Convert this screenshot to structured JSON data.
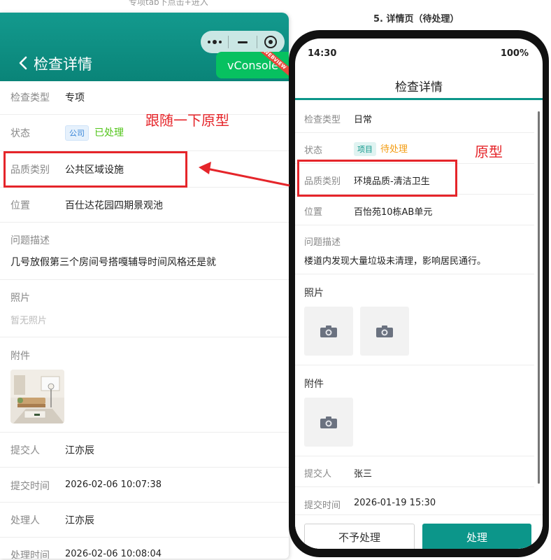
{
  "captions": {
    "top": "专项tab下点击+进入",
    "right": "5. 详情页（待处理）"
  },
  "left": {
    "title": "检查详情",
    "vconsole": "vConsole",
    "ribbon": "WEBVIEW",
    "inspect_type": {
      "label": "检查类型",
      "value": "专项"
    },
    "status": {
      "label": "状态",
      "tag": "公司",
      "value": "已处理"
    },
    "quality_category": {
      "label": "品质类别",
      "value": "公共区域设施"
    },
    "location": {
      "label": "位置",
      "value": "百仕达花园四期景观池"
    },
    "problem": {
      "label": "问题描述",
      "value": "几号放假第三个房间号搭嘎辅导时间风格还是就"
    },
    "photos": {
      "label": "照片",
      "empty": "暂无照片"
    },
    "attachments": {
      "label": "附件"
    },
    "submitter": {
      "label": "提交人",
      "value": "江亦辰"
    },
    "submit_time": {
      "label": "提交时间",
      "value": "2026-02-06 10:07:38"
    },
    "handler": {
      "label": "处理人",
      "value": "江亦辰"
    },
    "handle_time": {
      "label": "处理时间",
      "value": "2026-02-06 10:08:04"
    }
  },
  "annotations": {
    "follow": "跟随一下原型",
    "prototype": "原型"
  },
  "right": {
    "time": "14:30",
    "battery": "100%",
    "title": "检查详情",
    "inspect_type": {
      "label": "检查类型",
      "value": "日常"
    },
    "status": {
      "label": "状态",
      "tag": "项目",
      "value": "待处理"
    },
    "quality_category": {
      "label": "品质类别",
      "value": "环境品质-清洁卫生"
    },
    "location": {
      "label": "位置",
      "value": "百怡苑10栋AB单元"
    },
    "problem": {
      "label": "问题描述",
      "value": "楼道内发现大量垃圾未清理，影响居民通行。"
    },
    "photos": {
      "label": "照片"
    },
    "attachments": {
      "label": "附件"
    },
    "submitter": {
      "label": "提交人",
      "value": "张三"
    },
    "submit_time": {
      "label": "提交时间",
      "value": "2026-01-19 15:30"
    },
    "buttons": {
      "reject": "不予处理",
      "process": "处理"
    }
  },
  "colors": {
    "brand_teal": "#0c968a",
    "annotation_red": "#e5252a",
    "processed_green": "#52c41a",
    "pending_orange": "#f39c12",
    "vconsole_green": "#07c160"
  }
}
